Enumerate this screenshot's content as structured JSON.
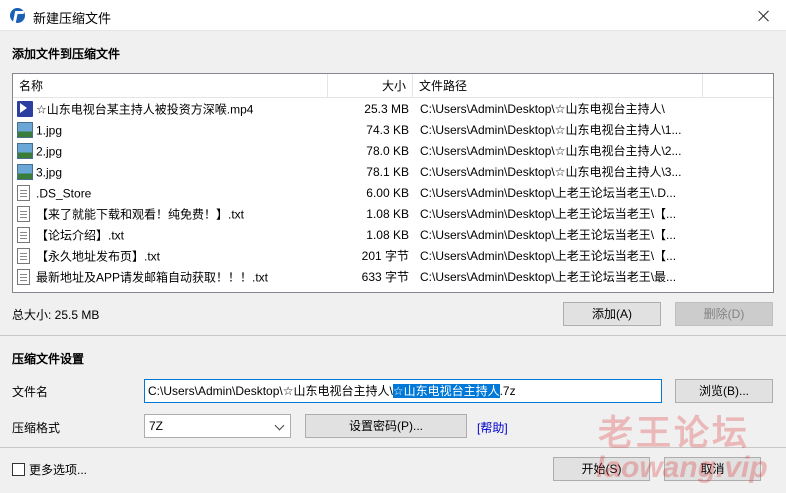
{
  "window": {
    "title": "新建压缩文件",
    "close_icon": "close-icon"
  },
  "add_section": {
    "heading": "添加文件到压缩文件"
  },
  "file_list": {
    "columns": {
      "name": "名称",
      "size": "大小",
      "path": "文件路径"
    },
    "rows": [
      {
        "icon": "video-file-icon",
        "name": "☆山东电视台某主持人被投资方深喉.mp4",
        "size": "25.3 MB",
        "path": "C:\\Users\\Admin\\Desktop\\☆山东电视台主持人\\"
      },
      {
        "icon": "image-file-icon",
        "name": "1.jpg",
        "size": "74.3 KB",
        "path": "C:\\Users\\Admin\\Desktop\\☆山东电视台主持人\\1..."
      },
      {
        "icon": "image-file-icon",
        "name": "2.jpg",
        "size": "78.0 KB",
        "path": "C:\\Users\\Admin\\Desktop\\☆山东电视台主持人\\2..."
      },
      {
        "icon": "image-file-icon",
        "name": "3.jpg",
        "size": "78.1 KB",
        "path": "C:\\Users\\Admin\\Desktop\\☆山东电视台主持人\\3..."
      },
      {
        "icon": "document-file-icon",
        "name": ".DS_Store",
        "size": "6.00 KB",
        "path": "C:\\Users\\Admin\\Desktop\\上老王论坛当老王\\.D..."
      },
      {
        "icon": "document-file-icon",
        "name": "【来了就能下载和观看！纯免费！】.txt",
        "size": "1.08 KB",
        "path": "C:\\Users\\Admin\\Desktop\\上老王论坛当老王\\【..."
      },
      {
        "icon": "document-file-icon",
        "name": "【论坛介绍】.txt",
        "size": "1.08 KB",
        "path": "C:\\Users\\Admin\\Desktop\\上老王论坛当老王\\【..."
      },
      {
        "icon": "document-file-icon",
        "name": "【永久地址发布页】.txt",
        "size": "201 字节",
        "path": "C:\\Users\\Admin\\Desktop\\上老王论坛当老王\\【..."
      },
      {
        "icon": "document-file-icon",
        "name": "最新地址及APP请发邮箱自动获取！！！.txt",
        "size": "633 字节",
        "path": "C:\\Users\\Admin\\Desktop\\上老王论坛当老王\\最..."
      }
    ]
  },
  "total_size": "总大小: 25.5 MB",
  "buttons": {
    "add": "添加(A)",
    "delete": "删除(D)",
    "browse": "浏览(B)...",
    "password": "设置密码(P)...",
    "start": "开始(S)",
    "cancel": "取消"
  },
  "settings": {
    "heading": "压缩文件设置",
    "filename_label": "文件名",
    "filename_value_prefix": "C:\\Users\\Admin\\Desktop\\☆山东电视台主持人\\",
    "filename_value_selected": "☆山东电视台主持人",
    "filename_value_suffix": ".7z",
    "format_label": "压缩格式",
    "format_value": "7Z",
    "help_link": "[帮助]"
  },
  "more_options": {
    "label": "更多选项...",
    "checked": false
  },
  "watermark": {
    "line1": "老王论坛",
    "line2": "laowang.vip"
  }
}
